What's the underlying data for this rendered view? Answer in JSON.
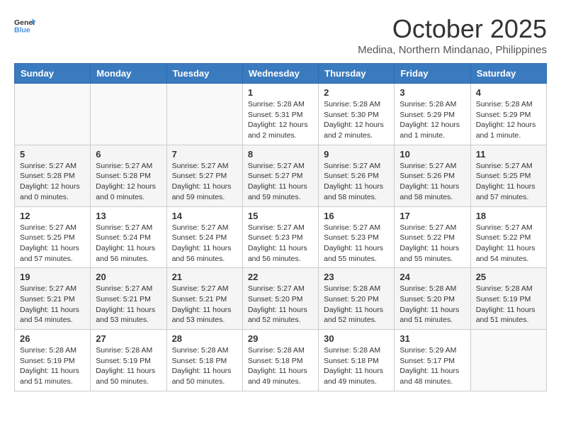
{
  "header": {
    "logo_line1": "General",
    "logo_line2": "Blue",
    "month": "October 2025",
    "location": "Medina, Northern Mindanao, Philippines"
  },
  "days_of_week": [
    "Sunday",
    "Monday",
    "Tuesday",
    "Wednesday",
    "Thursday",
    "Friday",
    "Saturday"
  ],
  "weeks": [
    [
      {
        "day": "",
        "content": ""
      },
      {
        "day": "",
        "content": ""
      },
      {
        "day": "",
        "content": ""
      },
      {
        "day": "1",
        "content": "Sunrise: 5:28 AM\nSunset: 5:31 PM\nDaylight: 12 hours\nand 2 minutes."
      },
      {
        "day": "2",
        "content": "Sunrise: 5:28 AM\nSunset: 5:30 PM\nDaylight: 12 hours\nand 2 minutes."
      },
      {
        "day": "3",
        "content": "Sunrise: 5:28 AM\nSunset: 5:29 PM\nDaylight: 12 hours\nand 1 minute."
      },
      {
        "day": "4",
        "content": "Sunrise: 5:28 AM\nSunset: 5:29 PM\nDaylight: 12 hours\nand 1 minute."
      }
    ],
    [
      {
        "day": "5",
        "content": "Sunrise: 5:27 AM\nSunset: 5:28 PM\nDaylight: 12 hours\nand 0 minutes."
      },
      {
        "day": "6",
        "content": "Sunrise: 5:27 AM\nSunset: 5:28 PM\nDaylight: 12 hours\nand 0 minutes."
      },
      {
        "day": "7",
        "content": "Sunrise: 5:27 AM\nSunset: 5:27 PM\nDaylight: 11 hours\nand 59 minutes."
      },
      {
        "day": "8",
        "content": "Sunrise: 5:27 AM\nSunset: 5:27 PM\nDaylight: 11 hours\nand 59 minutes."
      },
      {
        "day": "9",
        "content": "Sunrise: 5:27 AM\nSunset: 5:26 PM\nDaylight: 11 hours\nand 58 minutes."
      },
      {
        "day": "10",
        "content": "Sunrise: 5:27 AM\nSunset: 5:26 PM\nDaylight: 11 hours\nand 58 minutes."
      },
      {
        "day": "11",
        "content": "Sunrise: 5:27 AM\nSunset: 5:25 PM\nDaylight: 11 hours\nand 57 minutes."
      }
    ],
    [
      {
        "day": "12",
        "content": "Sunrise: 5:27 AM\nSunset: 5:25 PM\nDaylight: 11 hours\nand 57 minutes."
      },
      {
        "day": "13",
        "content": "Sunrise: 5:27 AM\nSunset: 5:24 PM\nDaylight: 11 hours\nand 56 minutes."
      },
      {
        "day": "14",
        "content": "Sunrise: 5:27 AM\nSunset: 5:24 PM\nDaylight: 11 hours\nand 56 minutes."
      },
      {
        "day": "15",
        "content": "Sunrise: 5:27 AM\nSunset: 5:23 PM\nDaylight: 11 hours\nand 56 minutes."
      },
      {
        "day": "16",
        "content": "Sunrise: 5:27 AM\nSunset: 5:23 PM\nDaylight: 11 hours\nand 55 minutes."
      },
      {
        "day": "17",
        "content": "Sunrise: 5:27 AM\nSunset: 5:22 PM\nDaylight: 11 hours\nand 55 minutes."
      },
      {
        "day": "18",
        "content": "Sunrise: 5:27 AM\nSunset: 5:22 PM\nDaylight: 11 hours\nand 54 minutes."
      }
    ],
    [
      {
        "day": "19",
        "content": "Sunrise: 5:27 AM\nSunset: 5:21 PM\nDaylight: 11 hours\nand 54 minutes."
      },
      {
        "day": "20",
        "content": "Sunrise: 5:27 AM\nSunset: 5:21 PM\nDaylight: 11 hours\nand 53 minutes."
      },
      {
        "day": "21",
        "content": "Sunrise: 5:27 AM\nSunset: 5:21 PM\nDaylight: 11 hours\nand 53 minutes."
      },
      {
        "day": "22",
        "content": "Sunrise: 5:27 AM\nSunset: 5:20 PM\nDaylight: 11 hours\nand 52 minutes."
      },
      {
        "day": "23",
        "content": "Sunrise: 5:28 AM\nSunset: 5:20 PM\nDaylight: 11 hours\nand 52 minutes."
      },
      {
        "day": "24",
        "content": "Sunrise: 5:28 AM\nSunset: 5:20 PM\nDaylight: 11 hours\nand 51 minutes."
      },
      {
        "day": "25",
        "content": "Sunrise: 5:28 AM\nSunset: 5:19 PM\nDaylight: 11 hours\nand 51 minutes."
      }
    ],
    [
      {
        "day": "26",
        "content": "Sunrise: 5:28 AM\nSunset: 5:19 PM\nDaylight: 11 hours\nand 51 minutes."
      },
      {
        "day": "27",
        "content": "Sunrise: 5:28 AM\nSunset: 5:19 PM\nDaylight: 11 hours\nand 50 minutes."
      },
      {
        "day": "28",
        "content": "Sunrise: 5:28 AM\nSunset: 5:18 PM\nDaylight: 11 hours\nand 50 minutes."
      },
      {
        "day": "29",
        "content": "Sunrise: 5:28 AM\nSunset: 5:18 PM\nDaylight: 11 hours\nand 49 minutes."
      },
      {
        "day": "30",
        "content": "Sunrise: 5:28 AM\nSunset: 5:18 PM\nDaylight: 11 hours\nand 49 minutes."
      },
      {
        "day": "31",
        "content": "Sunrise: 5:29 AM\nSunset: 5:17 PM\nDaylight: 11 hours\nand 48 minutes."
      },
      {
        "day": "",
        "content": ""
      }
    ]
  ]
}
